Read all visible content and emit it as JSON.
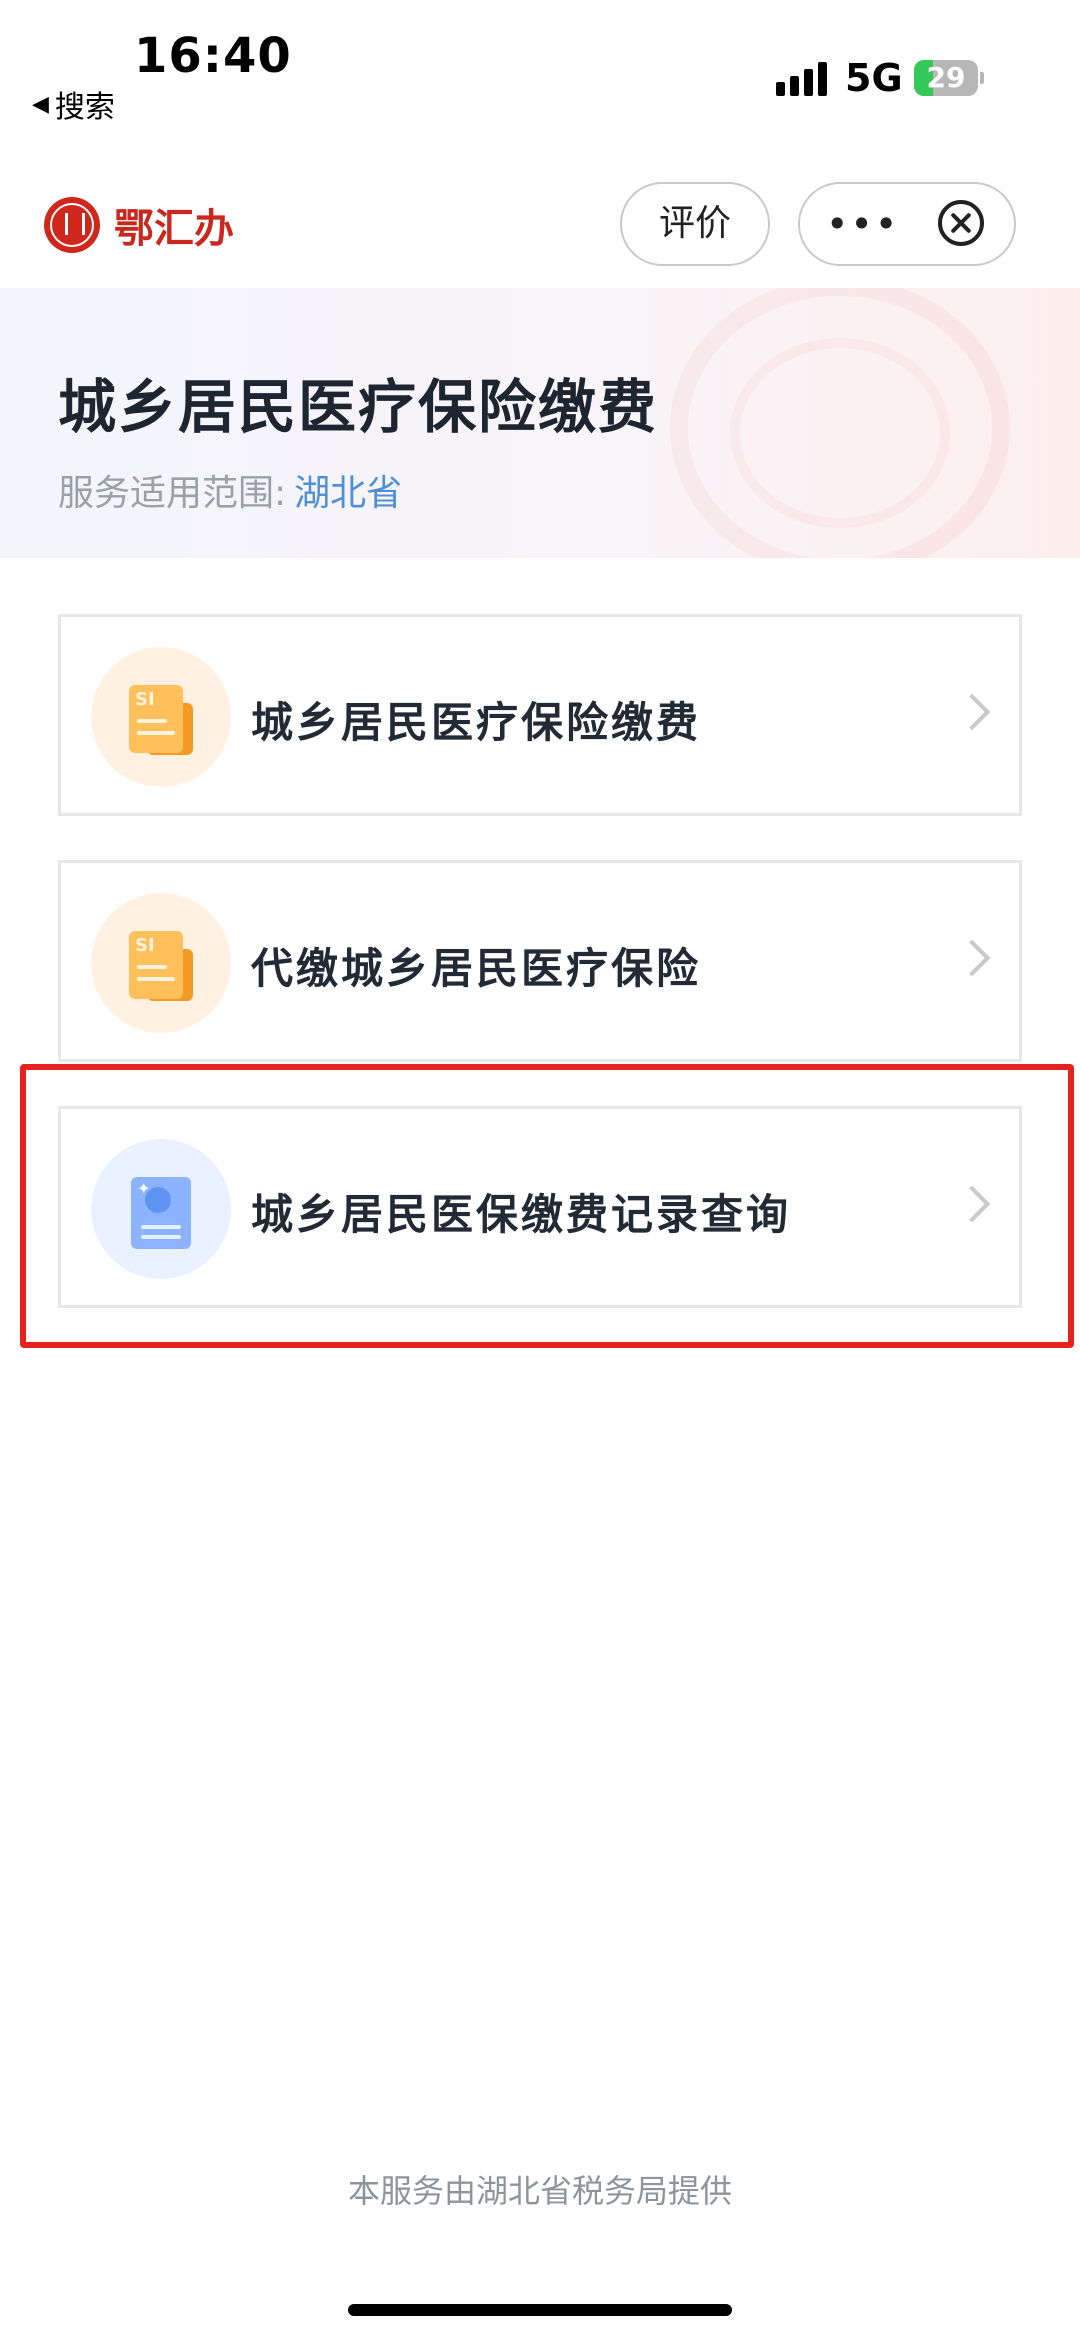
{
  "status_bar": {
    "time": "16:40",
    "back_label": "搜索",
    "network": "5G",
    "battery": "29",
    "battery_level": 0.29,
    "icons": [
      "back-triangle-icon",
      "signal-icon",
      "battery-icon"
    ]
  },
  "navbar": {
    "brand_name": "鄂汇办",
    "rate_label": "评价",
    "more_label": "•••",
    "icons": [
      "brand-logo-icon",
      "more-icon",
      "close-circle-icon"
    ]
  },
  "header": {
    "title": "城乡居民医疗保险缴费",
    "scope_label": "服务适用范围:",
    "scope_value": "湖北省"
  },
  "services": [
    {
      "label": "城乡居民医疗保险缴费",
      "icon": "document-si-icon",
      "color": "#ffbf5a"
    },
    {
      "label": "代缴城乡居民医疗保险",
      "icon": "document-si-icon",
      "color": "#ffbf5a"
    },
    {
      "label": "城乡居民医保缴费记录查询",
      "icon": "record-query-icon",
      "color": "#8cb3ff"
    }
  ],
  "highlight_color": "#e5221d",
  "footer": "本服务由湖北省税务局提供"
}
